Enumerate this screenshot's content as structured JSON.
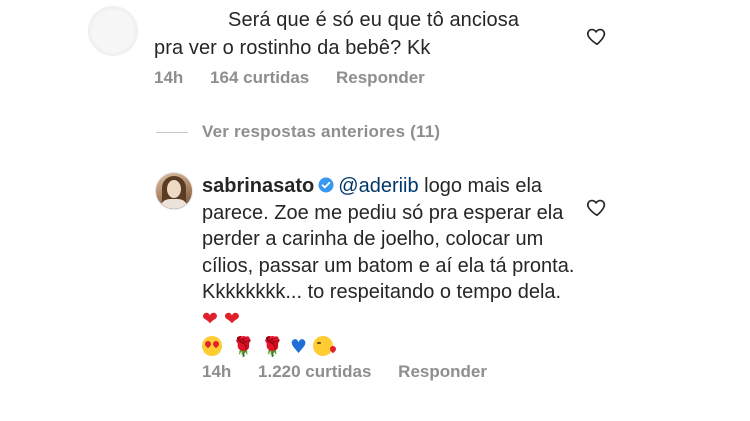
{
  "first_comment": {
    "text_line1": "Será que é só eu que tô anciosa",
    "text_line2": "pra ver o rostinho da bebê? Kk",
    "time": "14h",
    "likes": "164 curtidas",
    "reply_label": "Responder"
  },
  "view_previous": {
    "label": "Ver respostas anteriores (11)"
  },
  "reply_comment": {
    "username": "sabrinasato",
    "mention": "@aderiib",
    "text_after_mention": " logo mais ela parece. Zoe me pediu só pra esperar ela perder a carinha de joelho, colocar um cílios, passar um batom e aí ela tá pronta. Kkkkkkkk... to respeitando o tempo dela. ",
    "hearts_inline": "❤ ❤",
    "emoji_roses": "🌹",
    "emoji_blue_heart": "♥",
    "time": "14h",
    "likes": "1.220 curtidas",
    "reply_label": "Responder"
  },
  "icons": {
    "like_icon": "heart-outline-icon",
    "verified_icon": "verified-badge-icon"
  },
  "colors": {
    "text": "#262626",
    "meta": "#8e8e8e",
    "mention": "#00376b",
    "verified": "#3897f0",
    "heart_emoji": "#e0202a"
  }
}
